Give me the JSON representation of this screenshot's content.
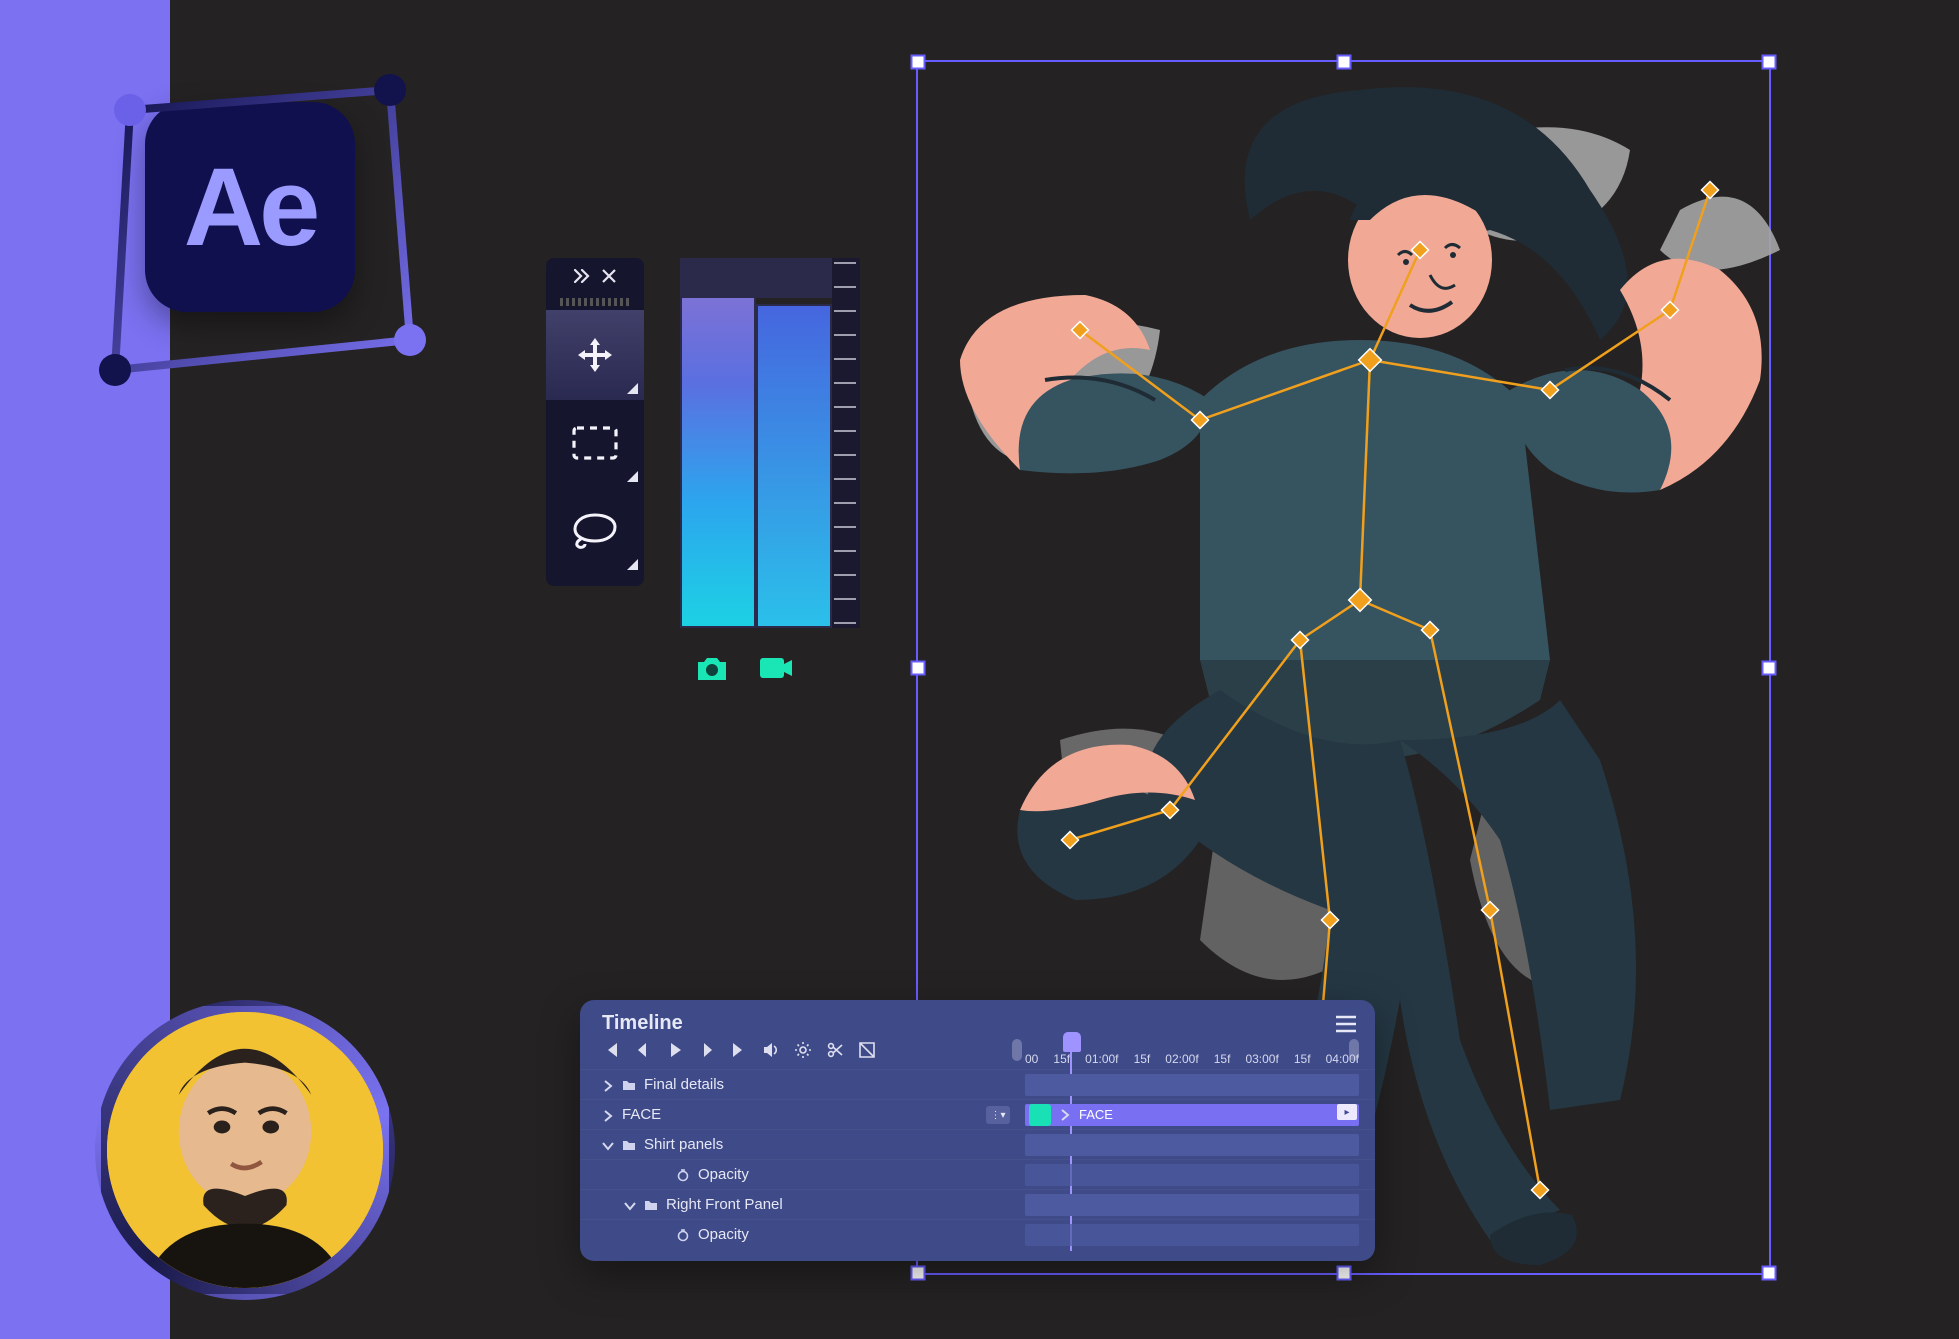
{
  "app": {
    "logo_text": "Ae"
  },
  "toolbox": {
    "collapse_icon": "chevrons-right-icon",
    "close_icon": "close-icon",
    "tools": [
      {
        "name": "move-tool",
        "selected": true
      },
      {
        "name": "marquee-tool",
        "selected": false
      },
      {
        "name": "lasso-tool",
        "selected": false
      }
    ]
  },
  "mini_icons": {
    "camera": "camera-icon",
    "video": "video-icon"
  },
  "timeline": {
    "title": "Timeline",
    "ruler": [
      "00",
      "15f",
      "01:00f",
      "15f",
      "02:00f",
      "15f",
      "03:00f",
      "15f",
      "04:00f"
    ],
    "rows": [
      {
        "kind": "folder",
        "state": "closed",
        "label": "Final details"
      },
      {
        "kind": "clip",
        "state": "closed",
        "label": "FACE",
        "clip_label": "FACE"
      },
      {
        "kind": "folder",
        "state": "open",
        "label": "Shirt panels"
      },
      {
        "kind": "prop",
        "label": "Opacity",
        "indent": 2
      },
      {
        "kind": "folder",
        "state": "open",
        "label": "Right Front Panel",
        "indent": 1
      },
      {
        "kind": "prop",
        "label": "Opacity",
        "indent": 2
      }
    ],
    "transport": {
      "first": "skip-start-icon",
      "prev": "step-back-icon",
      "play": "play-icon",
      "next": "step-fwd-icon",
      "last": "skip-end-icon",
      "audio": "speaker-icon",
      "settings": "gear-icon",
      "cut": "scissors-icon",
      "split": "split-icon"
    }
  }
}
